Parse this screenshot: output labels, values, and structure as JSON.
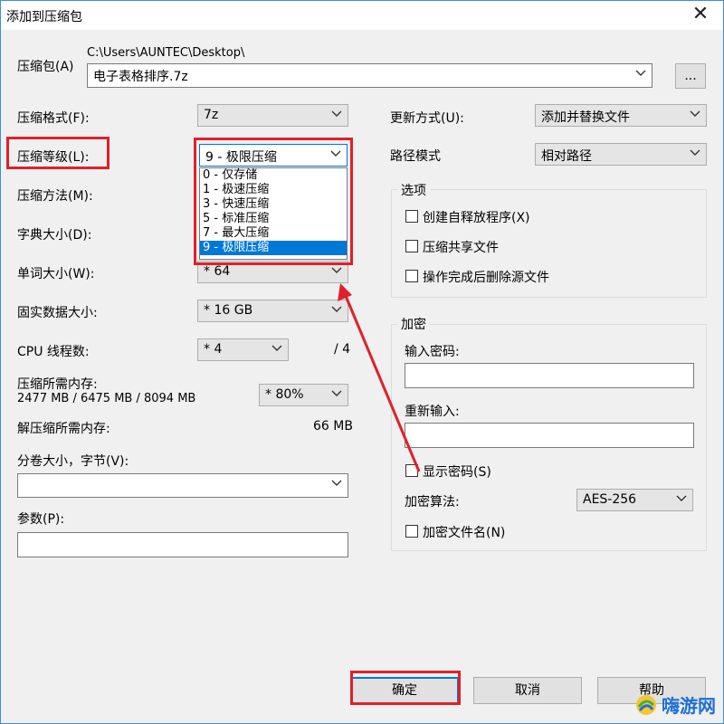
{
  "window": {
    "title": "添加到压缩包",
    "close_icon": "close-icon"
  },
  "archive": {
    "label": "压缩包(A)",
    "path": "C:\\Users\\AUNTEC\\Desktop\\",
    "name": "电子表格排序.7z",
    "browse_label": "..."
  },
  "left": {
    "format_label": "压缩格式(F):",
    "format_value": "7z",
    "level_label": "压缩等级(L):",
    "level_value": "9 - 极限压缩",
    "level_options": [
      "0 - 仅存储",
      "1 - 极速压缩",
      "3 - 快速压缩",
      "5 - 标准压缩",
      "7 - 最大压缩",
      "9 - 极限压缩"
    ],
    "method_label": "压缩方法(M):",
    "dict_label": "字典大小(D):",
    "word_label": "单词大小(W):",
    "word_value": "* 64",
    "solid_label": "固实数据大小:",
    "solid_value": "* 16 GB",
    "cpu_label": "CPU 线程数:",
    "cpu_value": "* 4",
    "cpu_total": "/ 4",
    "mem_label": "压缩所需内存:",
    "mem_detail": "2477 MB / 6475 MB / 8094 MB",
    "mem_percent": "* 80%",
    "decomp_label": "解压缩所需内存:",
    "decomp_value": "66 MB",
    "volume_label": "分卷大小，字节(V):",
    "volume_value": "",
    "params_label": "参数(P):",
    "params_value": ""
  },
  "right": {
    "update_label": "更新方式(U):",
    "update_value": "添加并替换文件",
    "path_label": "路径模式",
    "path_value": "相对路径",
    "options_title": "选项",
    "opt_sfx": "创建自释放程序(X)",
    "opt_shared": "压缩共享文件",
    "opt_delete": "操作完成后删除源文件",
    "enc_title": "加密",
    "enc_pwd_label": "输入密码:",
    "enc_pwd_value": "",
    "enc_repeat_label": "重新输入:",
    "enc_repeat_value": "",
    "show_pwd": "显示密码(S)",
    "enc_method_label": "加密算法:",
    "enc_method_value": "AES-256",
    "enc_names": "加密文件名(N)"
  },
  "buttons": {
    "ok": "确定",
    "cancel": "取消",
    "help": "帮助"
  },
  "watermark": {
    "text": "嗨游网"
  },
  "colors": {
    "highlight": "#e0202a",
    "selection": "#0078d7"
  }
}
